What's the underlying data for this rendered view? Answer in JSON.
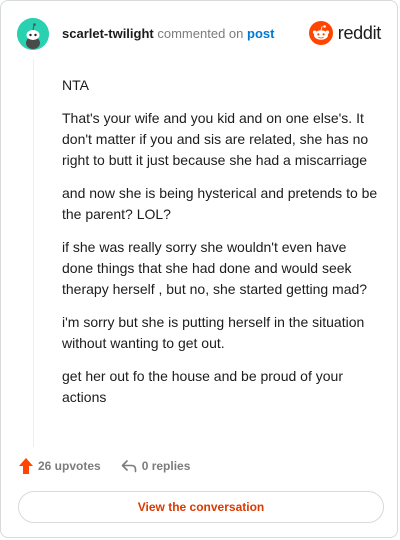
{
  "header": {
    "username": "scarlet-twilight",
    "verb": "commented on",
    "link_text": "post",
    "logo_text": "reddit",
    "colors": {
      "avatar": "#2ad1b1",
      "logo": "#ff4500",
      "link": "#0079d3"
    },
    "icons": {
      "avatar": "snoo-avatar-icon",
      "logo": "reddit-snoo-icon"
    }
  },
  "comment": {
    "paragraphs": [
      "NTA",
      "That's your wife and you kid and on one else's. It don't matter if you and sis are related, she has no right to butt it just because she had a miscarriage",
      "and now she is being hysterical and pretends to be the parent? LOL?",
      "if she was really sorry she wouldn't even have done things that she had done and would seek therapy herself , but no, she started getting mad?",
      "i'm sorry but she is putting herself in the situation without wanting to get out.",
      "get her out fo the house and be proud of your actions"
    ]
  },
  "actions": {
    "upvotes": "26 upvotes",
    "replies": "0 replies",
    "icons": {
      "upvotes": "upvote-arrow-icon",
      "replies": "reply-arrow-icon"
    },
    "colors": {
      "upvote": "#ff4500"
    }
  },
  "cta": {
    "label": "View the conversation",
    "color": "#d93a00"
  }
}
